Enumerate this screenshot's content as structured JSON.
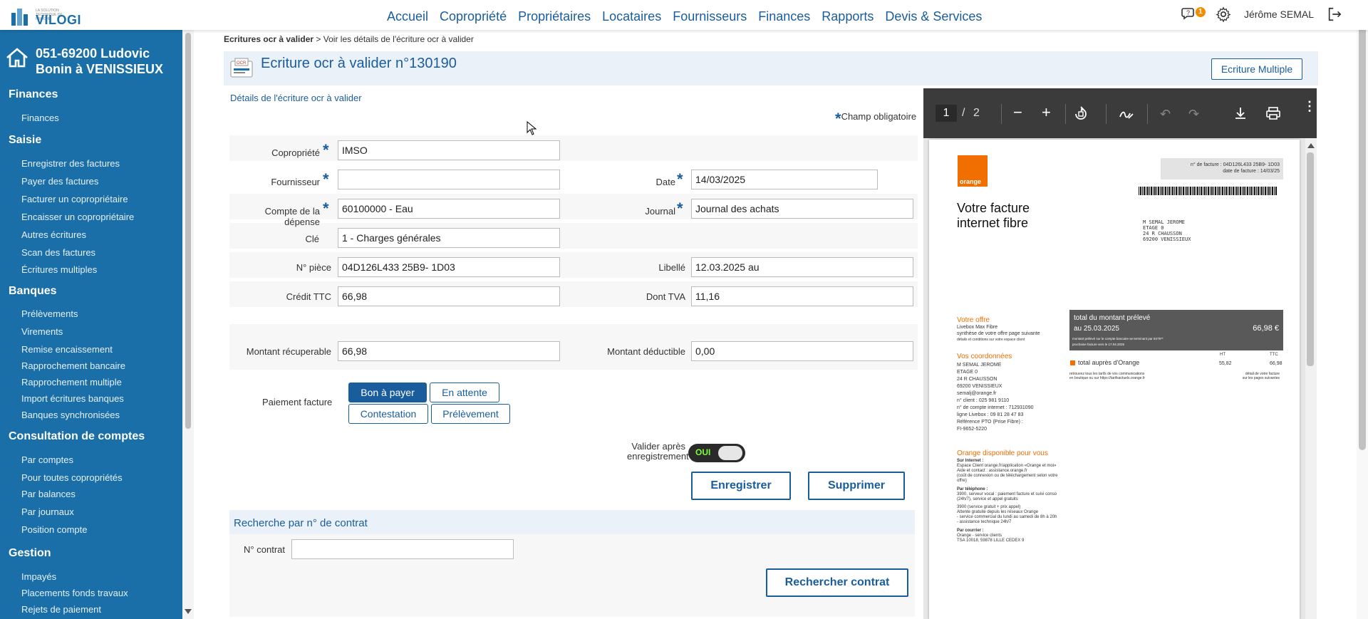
{
  "app": {
    "logo_text": "VILOGI",
    "logo_tagline": "LA SOLUTION TECHNIQUE DE PROCHE"
  },
  "nav": {
    "items": [
      "Accueil",
      "Copropriété",
      "Propriétaires",
      "Locataires",
      "Fournisseurs",
      "Finances",
      "Rapports",
      "Devis & Services"
    ],
    "notification_count": "1",
    "user_name": "Jérôme SEMAL"
  },
  "sidebar": {
    "title_line1": "051-69200 Ludovic",
    "title_line2": "Bonin à VENISSIEUX",
    "sections": [
      {
        "title": "Finances",
        "items": [
          "Finances"
        ]
      },
      {
        "title": "Saisie",
        "items": [
          "Enregistrer des factures",
          "Payer des factures",
          "Facturer un copropriétaire",
          "Encaisser un copropriétaire",
          "Autres écritures",
          "Scan des factures",
          "Écritures multiples"
        ]
      },
      {
        "title": "Banques",
        "items": [
          "Prélèvements",
          "Virements",
          "Remise encaissement",
          "Rapprochement bancaire",
          "Rapprochement multiple",
          "Import écritures banques",
          "Banques synchronisées"
        ]
      },
      {
        "title": "Consultation de comptes",
        "items": [
          "Par comptes",
          "Pour toutes copropriétés",
          "Par balances",
          "Par journaux",
          "Position compte"
        ]
      },
      {
        "title": "Gestion",
        "items": [
          "Impayés",
          "Placements fonds travaux",
          "Rejets de paiement"
        ]
      }
    ]
  },
  "breadcrumb": {
    "parent": "Ecritures ocr à valider",
    "separator": ">",
    "current": "Voir les détails de l'écriture ocr à valider"
  },
  "header": {
    "title": "Ecriture ocr à valider n°130190",
    "multi_button": "Ecriture Multiple",
    "icon_text": "OCR"
  },
  "form": {
    "section_title": "Détails de l'écriture ocr à valider",
    "required_note": "Champ obligatoire",
    "fields": {
      "copropriete": {
        "label": "Copropriété",
        "value": "IMSO"
      },
      "fournisseur": {
        "label": "Fournisseur",
        "value": ""
      },
      "date": {
        "label": "Date",
        "value": "14/03/2025"
      },
      "compte": {
        "label": "Compte de la dépense",
        "value": "60100000 - Eau"
      },
      "journal": {
        "label": "Journal",
        "value": "Journal des achats"
      },
      "cle": {
        "label": "Clé",
        "value": "1 - Charges générales"
      },
      "piece": {
        "label": "N° pièce",
        "value": "04D126L433 25B9- 1D03"
      },
      "libelle": {
        "label": "Libellé",
        "value": "12.03.2025 au"
      },
      "credit": {
        "label": "Crédit TTC",
        "value": "66,98"
      },
      "tva": {
        "label": "Dont TVA",
        "value": "11,16"
      },
      "recuperable": {
        "label": "Montant récuperable",
        "value": "66,98"
      },
      "deductible": {
        "label": "Montant déductible",
        "value": "0,00"
      }
    },
    "payment": {
      "label": "Paiement facture",
      "options": [
        "Bon à payer",
        "En attente",
        "Contestation",
        "Prélèvement"
      ],
      "selected": "Bon à payer"
    },
    "validate_toggle": {
      "label_line1": "Valider après",
      "label_line2": "enregistrement",
      "state": "OUI"
    },
    "save_button": "Enregistrer",
    "delete_button": "Supprimer"
  },
  "contract_search": {
    "title": "Recherche par n° de contrat",
    "field_label": "N° contrat",
    "field_value": "",
    "button": "Rechercher contrat"
  },
  "pdf_viewer": {
    "current_page": "1",
    "page_separator": "/",
    "total_pages": "2"
  },
  "invoice": {
    "brand": "orange",
    "invoice_no_line": "n° de facture : 04D126L433 25B9- 1D03",
    "invoice_date_line": "date de facture : 14/03/25",
    "title_line1": "Votre facture",
    "title_line2": "internet fibre",
    "address": [
      "M SEMAL JEROME",
      "ETAGE 0",
      "24 R CHAUSSON",
      "69200 VENISSIEUX"
    ],
    "offer_heading": "Votre offre",
    "offer_lines": [
      "Livebox Max Fibre",
      "synthèse de votre offre page suivante",
      "détails et conditions sur votre espace client"
    ],
    "total_box": {
      "line1": "total du montant prélevé",
      "line2": "au 25.03.2025",
      "amount": "66,98 €",
      "note1": "montant prélevé sur le compte bancaire se terminant par 8475**",
      "note2": "prochaine facture vers le 17.04.2025"
    },
    "coords_heading": "Vos coordonnées",
    "coords_lines": [
      "M SEMAL JEROME",
      "ETAGE 0",
      "24 R CHAUSSON",
      "69200 VENISSIEUX",
      "semalj@orange.fr",
      "n° client : 025 981 9110",
      "n° de compte internet : 712931090",
      "ligne Livebox : 09 81 28 47 83",
      "Référence PTO (Prise Fibre) :",
      "FI-9652-5220"
    ],
    "table": {
      "col_ht": "HT",
      "col_ttc": "TTC",
      "row_label": "total auprès d'Orange",
      "ht": "55,82",
      "ttc": "66,98"
    },
    "table_note1": "retrouvez tous les tarifs de vos communications",
    "table_note2": "en boutique ou sur https://tarifsactuels.orange.fr",
    "table_note3": "détail de votre facture",
    "table_note4": "sur les pages suivantes",
    "help_heading": "Orange disponible pour vous",
    "help_lines": [
      "Sur Internet :",
      "Espace Client orange.fr/application «Orange et moi»",
      "Aide et contact : assistance.orange.fr",
      "(coût de connexion ou de téléchargement selon votre offre)",
      "Par téléphone :",
      "3900, serveur vocal : paiement facture et suivi conso",
      "(24h/7), service et appel gratuits",
      "3900 (service gratuit + prix appel)",
      "Attente gratuite depuis les réseaux Orange",
      "- service commercial du lundi au samedi de 8h à 20h",
      "- assistance technique 24h/7",
      "Par courrier :",
      "Orange - service clients",
      "TSA 10018, 59878 LILLE CEDEX 9"
    ]
  }
}
